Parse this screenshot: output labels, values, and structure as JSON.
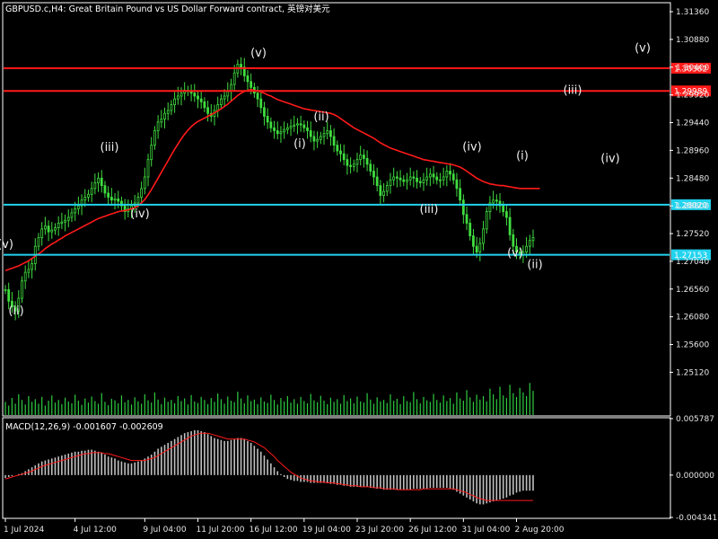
{
  "window": {
    "title": "GBPUSD.c,H4:  Great Britain Pound vs US Dollar Forward contract, 英镑对美元"
  },
  "chart_data": {
    "type": "candlestick",
    "symbol": "GBPUSD.c",
    "timeframe": "H4",
    "title": "GBPUSD.c,H4:  Great Britain Pound vs US Dollar Forward contract, 英镑对美元",
    "price_axis": {
      "ylim": [
        1.2438,
        1.315
      ],
      "tick_labels": [
        "1.31360",
        "1.30880",
        "1.30400",
        "1.29920",
        "1.29440",
        "1.28960",
        "1.28480",
        "1.28000",
        "1.27520",
        "1.27040",
        "1.26560",
        "1.26080",
        "1.25600",
        "1.25120"
      ],
      "ticks": [
        1.3136,
        1.3088,
        1.304,
        1.2992,
        1.2944,
        1.2896,
        1.2848,
        1.28,
        1.2752,
        1.2704,
        1.2656,
        1.2608,
        1.256,
        1.2512
      ]
    },
    "time_axis": {
      "tick_labels": [
        "1 Jul 2024",
        "4 Jul 12:00",
        "9 Jul 04:00",
        "11 Jul 20:00",
        "16 Jul 12:00",
        "19 Jul 04:00",
        "23 Jul 20:00",
        "26 Jul 12:00",
        "31 Jul 04:00",
        "2 Aug 20:00"
      ],
      "tick_bar_index": [
        0,
        21,
        42,
        58,
        74,
        90,
        106,
        122,
        138,
        154
      ],
      "bar_count": 160
    },
    "price_series": [
      1.2655,
      1.2635,
      1.2625,
      1.2618,
      1.264,
      1.267,
      1.2685,
      1.269,
      1.27,
      1.273,
      1.2745,
      1.276,
      1.2765,
      1.2755,
      1.2758,
      1.2762,
      1.277,
      1.2772,
      1.2775,
      1.278,
      1.2788,
      1.2795,
      1.28,
      1.281,
      1.2815,
      1.282,
      1.283,
      1.284,
      1.2848,
      1.2835,
      1.2822,
      1.2815,
      1.281,
      1.2812,
      1.2808,
      1.28,
      1.279,
      1.2795,
      1.28,
      1.2805,
      1.2815,
      1.283,
      1.285,
      1.288,
      1.2905,
      1.293,
      1.2945,
      1.295,
      1.296,
      1.2965,
      1.2975,
      1.2985,
      1.299,
      1.2995,
      1.3,
      1.2998,
      1.2995,
      1.299,
      1.2985,
      1.298,
      1.297,
      1.296,
      1.2955,
      1.2965,
      1.2975,
      1.2985,
      1.299,
      1.2998,
      1.301,
      1.303,
      1.3045,
      1.304,
      1.3025,
      1.3015,
      1.3005,
      1.2995,
      1.2985,
      1.297,
      1.2955,
      1.2945,
      1.2935,
      1.293,
      1.2925,
      1.2928,
      1.2932,
      1.2935,
      1.2938,
      1.294,
      1.2942,
      1.294,
      1.2935,
      1.293,
      1.292,
      1.2912,
      1.2915,
      1.292,
      1.2925,
      1.293,
      1.292,
      1.2905,
      1.2895,
      1.289,
      1.288,
      1.287,
      1.2868,
      1.2872,
      1.288,
      1.2888,
      1.2882,
      1.2872,
      1.286,
      1.285,
      1.2835,
      1.2818,
      1.2825,
      1.2835,
      1.2845,
      1.285,
      1.2848,
      1.2845,
      1.2842,
      1.2845,
      1.285,
      1.2848,
      1.2842,
      1.284,
      1.2845,
      1.285,
      1.2855,
      1.285,
      1.2845,
      1.2845,
      1.285,
      1.286,
      1.2855,
      1.2845,
      1.283,
      1.281,
      1.2785,
      1.277,
      1.2748,
      1.273,
      1.272,
      1.2735,
      1.276,
      1.279,
      1.2805,
      1.281,
      1.2808,
      1.28,
      1.279,
      1.278,
      1.275,
      1.273,
      1.272,
      1.2715,
      1.272,
      1.273,
      1.274,
      1.2745
    ],
    "moving_average": {
      "color": "#ff1a1a",
      "values": [
        1.2688,
        1.269,
        1.2692,
        1.2694,
        1.2696,
        1.2699,
        1.2702,
        1.2705,
        1.2709,
        1.2713,
        1.2717,
        1.2721,
        1.2726,
        1.273,
        1.2734,
        1.2737,
        1.2741,
        1.2744,
        1.2748,
        1.2751,
        1.2754,
        1.2757,
        1.276,
        1.2763,
        1.2766,
        1.2769,
        1.2772,
        1.2775,
        1.2778,
        1.278,
        1.2782,
        1.2784,
        1.2786,
        1.2788,
        1.279,
        1.2791,
        1.2792,
        1.2793,
        1.2795,
        1.2797,
        1.28,
        1.2805,
        1.2811,
        1.2819,
        1.2828,
        1.2838,
        1.2848,
        1.2858,
        1.2868,
        1.2878,
        1.2888,
        1.2898,
        1.2907,
        1.2916,
        1.2924,
        1.2931,
        1.2937,
        1.2942,
        1.2946,
        1.2949,
        1.2952,
        1.2955,
        1.2958,
        1.2961,
        1.2964,
        1.2968,
        1.2972,
        1.2976,
        1.2981,
        1.2986,
        1.2991,
        1.2995,
        1.2998,
        1.3,
        1.3001,
        1.3,
        1.2999,
        1.2997,
        1.2995,
        1.2992,
        1.299,
        1.2987,
        1.2984,
        1.2982,
        1.298,
        1.2978,
        1.2976,
        1.2974,
        1.2972,
        1.297,
        1.2968,
        1.2967,
        1.2966,
        1.2965,
        1.2964,
        1.2963,
        1.2962,
        1.2961,
        1.296,
        1.2958,
        1.2955,
        1.2951,
        1.2947,
        1.2943,
        1.2939,
        1.2935,
        1.2932,
        1.2929,
        1.2926,
        1.2923,
        1.292,
        1.2917,
        1.2913,
        1.2909,
        1.2906,
        1.2903,
        1.29,
        1.2898,
        1.2896,
        1.2894,
        1.2892,
        1.289,
        1.2888,
        1.2886,
        1.2884,
        1.2882,
        1.288,
        1.2879,
        1.2878,
        1.2877,
        1.2876,
        1.2875,
        1.2874,
        1.2873,
        1.2872,
        1.2871,
        1.2869,
        1.2867,
        1.2864,
        1.286,
        1.2856,
        1.2852,
        1.2848,
        1.2845,
        1.2842,
        1.284,
        1.2838,
        1.2837,
        1.2836,
        1.2835,
        1.2835,
        1.2834,
        1.2833,
        1.2832,
        1.2831,
        1.283,
        1.283,
        1.283,
        1.283,
        1.283,
        1.283,
        1.283
      ]
    },
    "horizontal_levels": [
      {
        "price": 1.30382,
        "label": "1.30382",
        "color": "#ff1a1a"
      },
      {
        "price": 1.29989,
        "label": "1.29989",
        "color": "#ff1a1a"
      },
      {
        "price": 1.2802,
        "label": "1.28020",
        "color": "#22d3ee"
      },
      {
        "price": 1.27153,
        "label": "1.27153",
        "color": "#22d3ee"
      }
    ],
    "wave_labels": [
      {
        "text": "(v)",
        "bar": 0,
        "price": 1.2727
      },
      {
        "text": "(ii)",
        "bar": 6,
        "price": 1.2612
      },
      {
        "text": "(iii)",
        "bar": 58,
        "price": 1.2895
      },
      {
        "text": "(iv)",
        "bar": 75,
        "price": 1.278
      },
      {
        "text": "(v)",
        "bar": 141,
        "price": 1.3058
      },
      {
        "text": "(ii)",
        "bar": 176,
        "price": 1.2948
      },
      {
        "text": "(i)",
        "bar": 164,
        "price": 1.2901
      },
      {
        "text": "(iii)",
        "bar": 236,
        "price": 1.2788
      },
      {
        "text": "(iv)",
        "bar": 260,
        "price": 1.2896
      },
      {
        "text": "(v)",
        "bar": 284,
        "price": 1.2712
      },
      {
        "text": "(ii)",
        "bar": 295,
        "price": 1.2692
      },
      {
        "text": "(i)",
        "bar": 288,
        "price": 1.288
      },
      {
        "text": "(iv)",
        "bar": 337,
        "price": 1.2876
      },
      {
        "text": "(iii)",
        "bar": 316,
        "price": 1.2994
      },
      {
        "text": "(v)",
        "bar": 355,
        "price": 1.3067
      }
    ],
    "volume": {
      "color": "#2ecc40",
      "values": [
        0.35,
        0.25,
        0.45,
        0.3,
        0.55,
        0.4,
        0.28,
        0.5,
        0.35,
        0.42,
        0.3,
        0.48,
        0.25,
        0.38,
        0.52,
        0.33,
        0.4,
        0.29,
        0.46,
        0.36,
        0.31,
        0.54,
        0.38,
        0.27,
        0.44,
        0.33,
        0.49,
        0.37,
        0.3,
        0.58,
        0.35,
        0.26,
        0.43,
        0.39,
        0.31,
        0.52,
        0.34,
        0.4,
        0.28,
        0.47,
        0.36,
        0.3,
        0.55,
        0.39,
        0.33,
        0.6,
        0.41,
        0.29,
        0.46,
        0.35,
        0.4,
        0.31,
        0.5,
        0.37,
        0.44,
        0.28,
        0.53,
        0.36,
        0.32,
        0.48,
        0.4,
        0.29,
        0.45,
        0.35,
        0.57,
        0.42,
        0.3,
        0.49,
        0.38,
        0.34,
        0.62,
        0.44,
        0.31,
        0.52,
        0.37,
        0.41,
        0.29,
        0.47,
        0.36,
        0.32,
        0.54,
        0.4,
        0.28,
        0.45,
        0.36,
        0.5,
        0.33,
        0.42,
        0.3,
        0.48,
        0.37,
        0.31,
        0.56,
        0.39,
        0.34,
        0.51,
        0.38,
        0.29,
        0.46,
        0.35,
        0.42,
        0.3,
        0.53,
        0.37,
        0.44,
        0.31,
        0.49,
        0.36,
        0.33,
        0.58,
        0.41,
        0.3,
        0.47,
        0.36,
        0.4,
        0.32,
        0.55,
        0.38,
        0.43,
        0.29,
        0.5,
        0.37,
        0.34,
        0.61,
        0.42,
        0.31,
        0.48,
        0.39,
        0.35,
        0.56,
        0.4,
        0.33,
        0.52,
        0.37,
        0.45,
        0.3,
        0.6,
        0.44,
        0.38,
        0.66,
        0.47,
        0.35,
        0.54,
        0.41,
        0.5,
        0.36,
        0.7,
        0.55,
        0.42,
        0.75,
        0.52,
        0.45,
        0.8,
        0.58,
        0.48,
        0.72,
        0.6,
        0.5,
        0.85,
        0.64
      ]
    },
    "macd": {
      "label": "MACD(12,26,9) -0.001607 -0.002609",
      "ylim": [
        -0.004341,
        0.005787
      ],
      "tick_labels": [
        "0.005787",
        "0.000000",
        "-0.004341"
      ],
      "ticks": [
        0.005787,
        0.0,
        -0.004341
      ],
      "histogram_color": "#c0c0c0",
      "signal_color": "#ff1a1a",
      "histogram": [
        -0.0003,
        -0.0002,
        -0.0001,
        0.0,
        0.0001,
        0.0002,
        0.0004,
        0.0006,
        0.0008,
        0.001,
        0.0012,
        0.0014,
        0.0015,
        0.0016,
        0.0017,
        0.0018,
        0.0019,
        0.002,
        0.0021,
        0.0022,
        0.0023,
        0.0024,
        0.0024,
        0.0025,
        0.0025,
        0.0026,
        0.0026,
        0.0025,
        0.0024,
        0.0023,
        0.0021,
        0.0019,
        0.0018,
        0.0017,
        0.0015,
        0.0014,
        0.0013,
        0.0012,
        0.0012,
        0.0013,
        0.0014,
        0.0015,
        0.0017,
        0.0019,
        0.0021,
        0.0024,
        0.0027,
        0.0029,
        0.0031,
        0.0033,
        0.0035,
        0.0037,
        0.0039,
        0.0041,
        0.0043,
        0.0044,
        0.0045,
        0.0046,
        0.0046,
        0.0045,
        0.0044,
        0.0042,
        0.004,
        0.0038,
        0.0037,
        0.0036,
        0.0035,
        0.0035,
        0.0036,
        0.0037,
        0.0038,
        0.0038,
        0.0037,
        0.0035,
        0.0033,
        0.003,
        0.0027,
        0.0024,
        0.002,
        0.0016,
        0.0012,
        0.0008,
        0.0004,
        0.0001,
        -0.0002,
        -0.0004,
        -0.0005,
        -0.0006,
        -0.0006,
        -0.0007,
        -0.0007,
        -0.0007,
        -0.0008,
        -0.0008,
        -0.0008,
        -0.0008,
        -0.0008,
        -0.0008,
        -0.0009,
        -0.0009,
        -0.001,
        -0.001,
        -0.0011,
        -0.0011,
        -0.0012,
        -0.0012,
        -0.0012,
        -0.0012,
        -0.0012,
        -0.0012,
        -0.0013,
        -0.0013,
        -0.0014,
        -0.0014,
        -0.0015,
        -0.0015,
        -0.0015,
        -0.0015,
        -0.0015,
        -0.0015,
        -0.0015,
        -0.0015,
        -0.0015,
        -0.0014,
        -0.0014,
        -0.0014,
        -0.0014,
        -0.0014,
        -0.0013,
        -0.0013,
        -0.0013,
        -0.0013,
        -0.0013,
        -0.0013,
        -0.0014,
        -0.0015,
        -0.0017,
        -0.0019,
        -0.0021,
        -0.0023,
        -0.0025,
        -0.0027,
        -0.0029,
        -0.003,
        -0.003,
        -0.0029,
        -0.0028,
        -0.0027,
        -0.0026,
        -0.0025,
        -0.0024,
        -0.0023,
        -0.0021,
        -0.002,
        -0.0018,
        -0.0017,
        -0.0016,
        -0.0016,
        -0.0016,
        -0.0016
      ],
      "signal": [
        -0.0004,
        -0.0003,
        -0.0002,
        -0.0001,
        0.0,
        0.0001,
        0.0002,
        0.0003,
        0.0004,
        0.0006,
        0.0007,
        0.0009,
        0.001,
        0.0011,
        0.0012,
        0.0013,
        0.0014,
        0.0015,
        0.0016,
        0.0017,
        0.0018,
        0.0019,
        0.002,
        0.0021,
        0.0022,
        0.0022,
        0.0023,
        0.0023,
        0.0023,
        0.0023,
        0.0022,
        0.0022,
        0.0021,
        0.002,
        0.0019,
        0.0018,
        0.0017,
        0.0016,
        0.0015,
        0.0015,
        0.0015,
        0.0015,
        0.0015,
        0.0016,
        0.0017,
        0.0018,
        0.002,
        0.0022,
        0.0024,
        0.0026,
        0.0028,
        0.003,
        0.0032,
        0.0034,
        0.0036,
        0.0038,
        0.004,
        0.0041,
        0.0042,
        0.0043,
        0.0043,
        0.0043,
        0.0042,
        0.0041,
        0.004,
        0.0039,
        0.0038,
        0.0037,
        0.0037,
        0.0037,
        0.0037,
        0.0037,
        0.0037,
        0.0036,
        0.0035,
        0.0034,
        0.0032,
        0.003,
        0.0028,
        0.0025,
        0.0022,
        0.0019,
        0.0015,
        0.0012,
        0.0009,
        0.0006,
        0.0003,
        0.0001,
        -0.0001,
        -0.0003,
        -0.0004,
        -0.0005,
        -0.0006,
        -0.0006,
        -0.0007,
        -0.0007,
        -0.0007,
        -0.0008,
        -0.0008,
        -0.0008,
        -0.0009,
        -0.0009,
        -0.001,
        -0.001,
        -0.0011,
        -0.0011,
        -0.0011,
        -0.0012,
        -0.0012,
        -0.0012,
        -0.0012,
        -0.0013,
        -0.0013,
        -0.0013,
        -0.0014,
        -0.0014,
        -0.0014,
        -0.0014,
        -0.0015,
        -0.0015,
        -0.0015,
        -0.0015,
        -0.0015,
        -0.0015,
        -0.0015,
        -0.0015,
        -0.0014,
        -0.0014,
        -0.0014,
        -0.0014,
        -0.0014,
        -0.0014,
        -0.0014,
        -0.0014,
        -0.0014,
        -0.0014,
        -0.0015,
        -0.0016,
        -0.0017,
        -0.0018,
        -0.002,
        -0.0021,
        -0.0023,
        -0.0024,
        -0.0025,
        -0.0026,
        -0.0026,
        -0.0026,
        -0.0026,
        -0.0026,
        -0.0026,
        -0.0026,
        -0.0026,
        -0.0026,
        -0.0026,
        -0.0026,
        -0.0026,
        -0.0026,
        -0.0026,
        -0.0026
      ]
    }
  }
}
